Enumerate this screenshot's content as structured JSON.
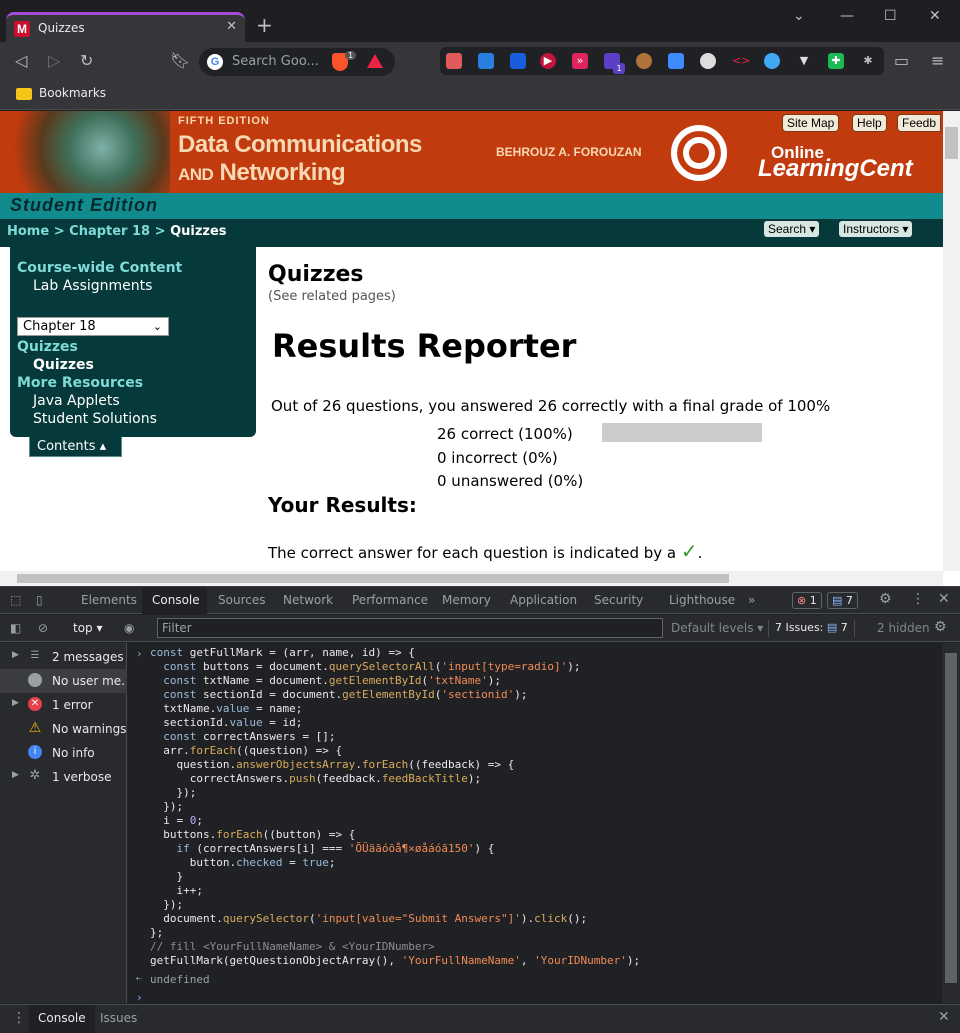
{
  "tab": {
    "title": "Quizzes",
    "favicon": "M"
  },
  "omnibox": {
    "placeholder": "Search Goo...",
    "brave_count": "1"
  },
  "bookmarks_bar": {
    "label": "Bookmarks"
  },
  "ext_badge": "1",
  "banner": {
    "edition": "FIFTH EDITION",
    "title1": "Data Communications",
    "title2_and": "AND",
    "title2": "Networking",
    "author": "BEHROUZ A. FOROUZAN",
    "olc_online": "Online",
    "olc_center": "LearningCent",
    "buttons": [
      "Site Map",
      "Help",
      "Feedb"
    ],
    "student_edition": "Student Edition"
  },
  "breadcrumb": {
    "home": "Home",
    "chapter": "Chapter 18",
    "current": "Quizzes",
    "sep": ">"
  },
  "topdd": {
    "search": "Search ▾",
    "instructors": "Instructors ▾"
  },
  "sidebar": {
    "course_wide": "Course-wide Content",
    "lab": "Lab Assignments",
    "chapter_select": "Chapter 18",
    "quizzes_h": "Quizzes",
    "quizzes_i": "Quizzes",
    "more": "More Resources",
    "java": "Java Applets",
    "solutions": "Student Solutions",
    "contents": "Contents ▴"
  },
  "main": {
    "heading": "Quizzes",
    "related": "(See related pages)",
    "reporter": "Results Reporter",
    "summary": "Out of 26 questions, you answered 26 correctly with a final grade of 100%",
    "correct": "26 correct (100%)",
    "incorrect": "0 incorrect (0%)",
    "unanswered": "0 unanswered (0%)",
    "your_results": "Your Results:",
    "answer_note": "The correct answer for each question is indicated by a",
    "check": "✓",
    "period": "."
  },
  "devtools": {
    "tabs": [
      "Elements",
      "Console",
      "Sources",
      "Network",
      "Performance",
      "Memory",
      "Application",
      "Security",
      "Lighthouse",
      "»"
    ],
    "errors_badge": "1",
    "msgs_badge": "7",
    "context": "top ▾",
    "filter_placeholder": "Filter",
    "levels": "Default levels ▾",
    "issues": "7 Issues:",
    "issues_count": "7",
    "hidden": "2 hidden",
    "sidebar": [
      {
        "label": "2 messages"
      },
      {
        "label": "No user me..."
      },
      {
        "label": "1 error"
      },
      {
        "label": "No warnings"
      },
      {
        "label": "No info"
      },
      {
        "label": "1 verbose"
      }
    ],
    "bottom_tabs": [
      "Console",
      "Issues"
    ],
    "undefined": "undefined"
  },
  "colors": {
    "brand": "#c23b0e",
    "teal_dark": "#063a3a",
    "teal": "#128b8e",
    "tab_accent": "#a64dd6"
  }
}
